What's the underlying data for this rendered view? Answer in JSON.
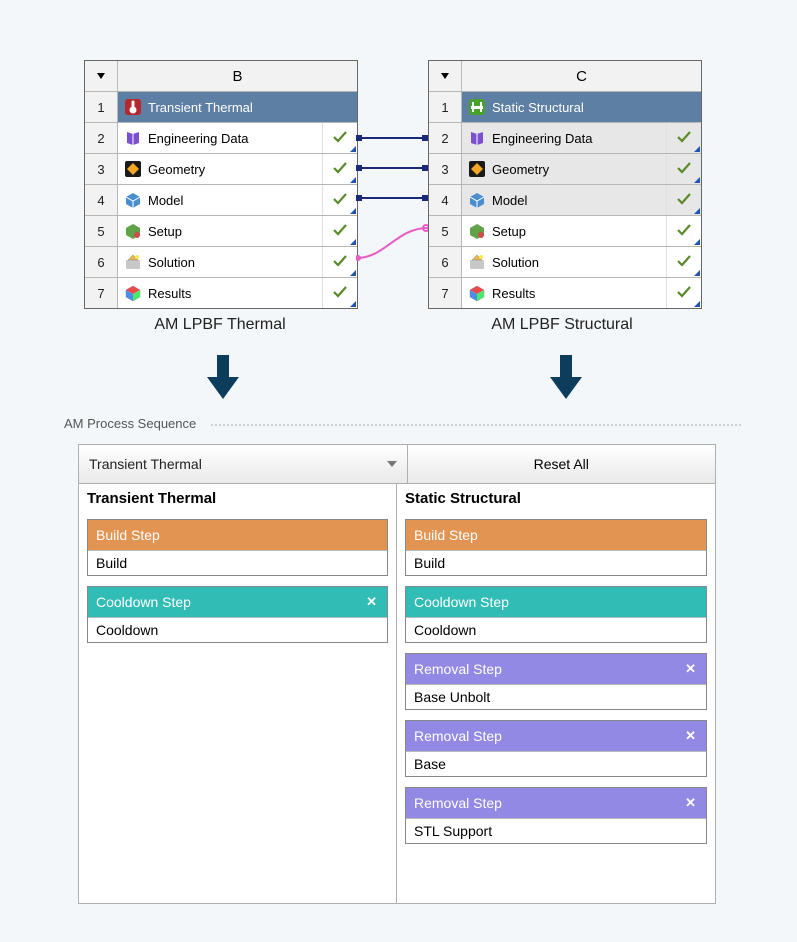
{
  "systems": {
    "left": {
      "column_letter": "B",
      "title": "Transient Thermal",
      "caption": "AM LPBF Thermal",
      "rows": [
        {
          "num": "1",
          "label": "Transient Thermal",
          "icon": "thermal-icon",
          "status": null,
          "title": true
        },
        {
          "num": "2",
          "label": "Engineering Data",
          "icon": "book-icon",
          "status": "check"
        },
        {
          "num": "3",
          "label": "Geometry",
          "icon": "geom-icon",
          "status": "check"
        },
        {
          "num": "4",
          "label": "Model",
          "icon": "model-icon",
          "status": "check"
        },
        {
          "num": "5",
          "label": "Setup",
          "icon": "setup-icon",
          "status": "check"
        },
        {
          "num": "6",
          "label": "Solution",
          "icon": "solution-icon",
          "status": "check"
        },
        {
          "num": "7",
          "label": "Results",
          "icon": "results-icon",
          "status": "check"
        }
      ]
    },
    "right": {
      "column_letter": "C",
      "title": "Static Structural",
      "caption": "AM LPBF Structural",
      "rows": [
        {
          "num": "1",
          "label": "Static Structural",
          "icon": "structural-icon",
          "status": null,
          "title": true
        },
        {
          "num": "2",
          "label": "Engineering Data",
          "icon": "book-icon",
          "status": "check",
          "shared": true
        },
        {
          "num": "3",
          "label": "Geometry",
          "icon": "geom-icon",
          "status": "check",
          "shared": true
        },
        {
          "num": "4",
          "label": "Model",
          "icon": "model-icon",
          "status": "check",
          "shared": true
        },
        {
          "num": "5",
          "label": "Setup",
          "icon": "setup-icon",
          "status": "check"
        },
        {
          "num": "6",
          "label": "Solution",
          "icon": "solution-icon",
          "status": "check"
        },
        {
          "num": "7",
          "label": "Results",
          "icon": "results-icon",
          "status": "check"
        }
      ]
    }
  },
  "process": {
    "panel_label": "AM Process Sequence",
    "dropdown_value": "Transient Thermal",
    "reset_label": "Reset All",
    "columns": [
      {
        "heading": "Transient Thermal",
        "steps": [
          {
            "type": "Build Step",
            "color": "orange",
            "items": [
              "Build"
            ],
            "closable": false
          },
          {
            "type": "Cooldown Step",
            "color": "teal",
            "items": [
              "Cooldown"
            ],
            "closable": true
          }
        ]
      },
      {
        "heading": "Static Structural",
        "steps": [
          {
            "type": "Build Step",
            "color": "orange",
            "items": [
              "Build"
            ],
            "closable": false
          },
          {
            "type": "Cooldown Step",
            "color": "teal",
            "items": [
              "Cooldown"
            ],
            "closable": false
          },
          {
            "type": "Removal Step",
            "color": "violet",
            "items": [
              "Base Unbolt"
            ],
            "closable": true
          },
          {
            "type": "Removal Step",
            "color": "violet",
            "items": [
              "Base"
            ],
            "closable": true
          },
          {
            "type": "Removal Step",
            "color": "violet",
            "items": [
              "STL Support"
            ],
            "closable": true
          }
        ]
      }
    ]
  }
}
